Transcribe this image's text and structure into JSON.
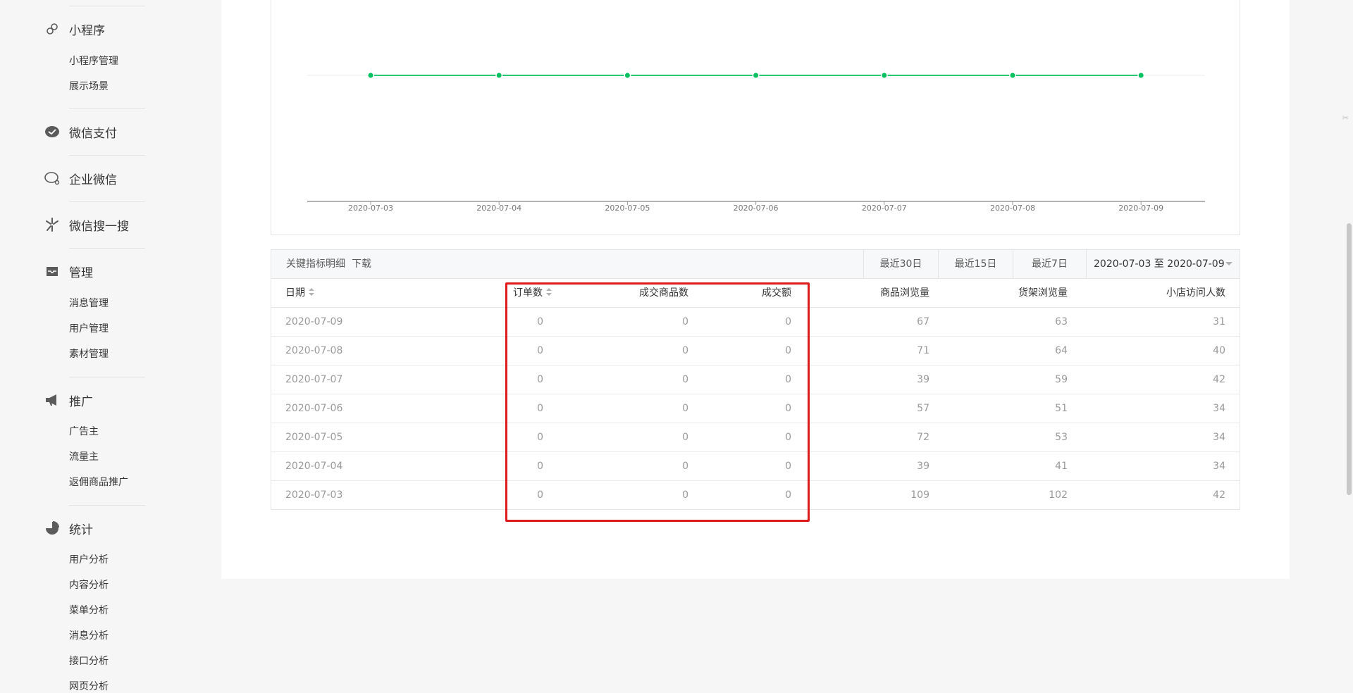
{
  "sidebar": {
    "miniprogram": {
      "label": "小程序",
      "items": [
        "小程序管理",
        "展示场景"
      ]
    },
    "wechat_pay": {
      "label": "微信支付"
    },
    "wecom": {
      "label": "企业微信"
    },
    "search": {
      "label": "微信搜一搜"
    },
    "manage": {
      "label": "管理",
      "items": [
        "消息管理",
        "用户管理",
        "素材管理"
      ]
    },
    "promotion": {
      "label": "推广",
      "items": [
        "广告主",
        "流量主",
        "返佣商品推广"
      ]
    },
    "stats": {
      "label": "统计",
      "items": [
        "用户分析",
        "内容分析",
        "菜单分析",
        "消息分析",
        "接口分析",
        "网页分析"
      ]
    }
  },
  "chart_data": {
    "type": "line",
    "x": [
      "2020-07-03",
      "2020-07-04",
      "2020-07-05",
      "2020-07-06",
      "2020-07-07",
      "2020-07-08",
      "2020-07-09"
    ],
    "series": [
      {
        "values": [
          0,
          0,
          0,
          0,
          0,
          0,
          0
        ]
      }
    ],
    "colors": {
      "line": "#07c160",
      "axis": "#9a9a9a",
      "tick_text": "#777777"
    },
    "grid": true
  },
  "table": {
    "title": "关键指标明细",
    "download": "下载",
    "ranges": [
      "最近30日",
      "最近15日",
      "最近7日"
    ],
    "date_range": "2020-07-03 至 2020-07-09",
    "columns": [
      "日期",
      "订单数",
      "成交商品数",
      "成交额",
      "商品浏览量",
      "货架浏览量",
      "小店访问人数"
    ],
    "rows": [
      [
        "2020-07-09",
        "0",
        "0",
        "0",
        "67",
        "63",
        "31"
      ],
      [
        "2020-07-08",
        "0",
        "0",
        "0",
        "71",
        "64",
        "40"
      ],
      [
        "2020-07-07",
        "0",
        "0",
        "0",
        "39",
        "59",
        "42"
      ],
      [
        "2020-07-06",
        "0",
        "0",
        "0",
        "57",
        "51",
        "34"
      ],
      [
        "2020-07-05",
        "0",
        "0",
        "0",
        "72",
        "53",
        "34"
      ],
      [
        "2020-07-04",
        "0",
        "0",
        "0",
        "39",
        "41",
        "34"
      ],
      [
        "2020-07-03",
        "0",
        "0",
        "0",
        "109",
        "102",
        "42"
      ]
    ]
  },
  "annotation": {
    "color": "#e0191b"
  }
}
